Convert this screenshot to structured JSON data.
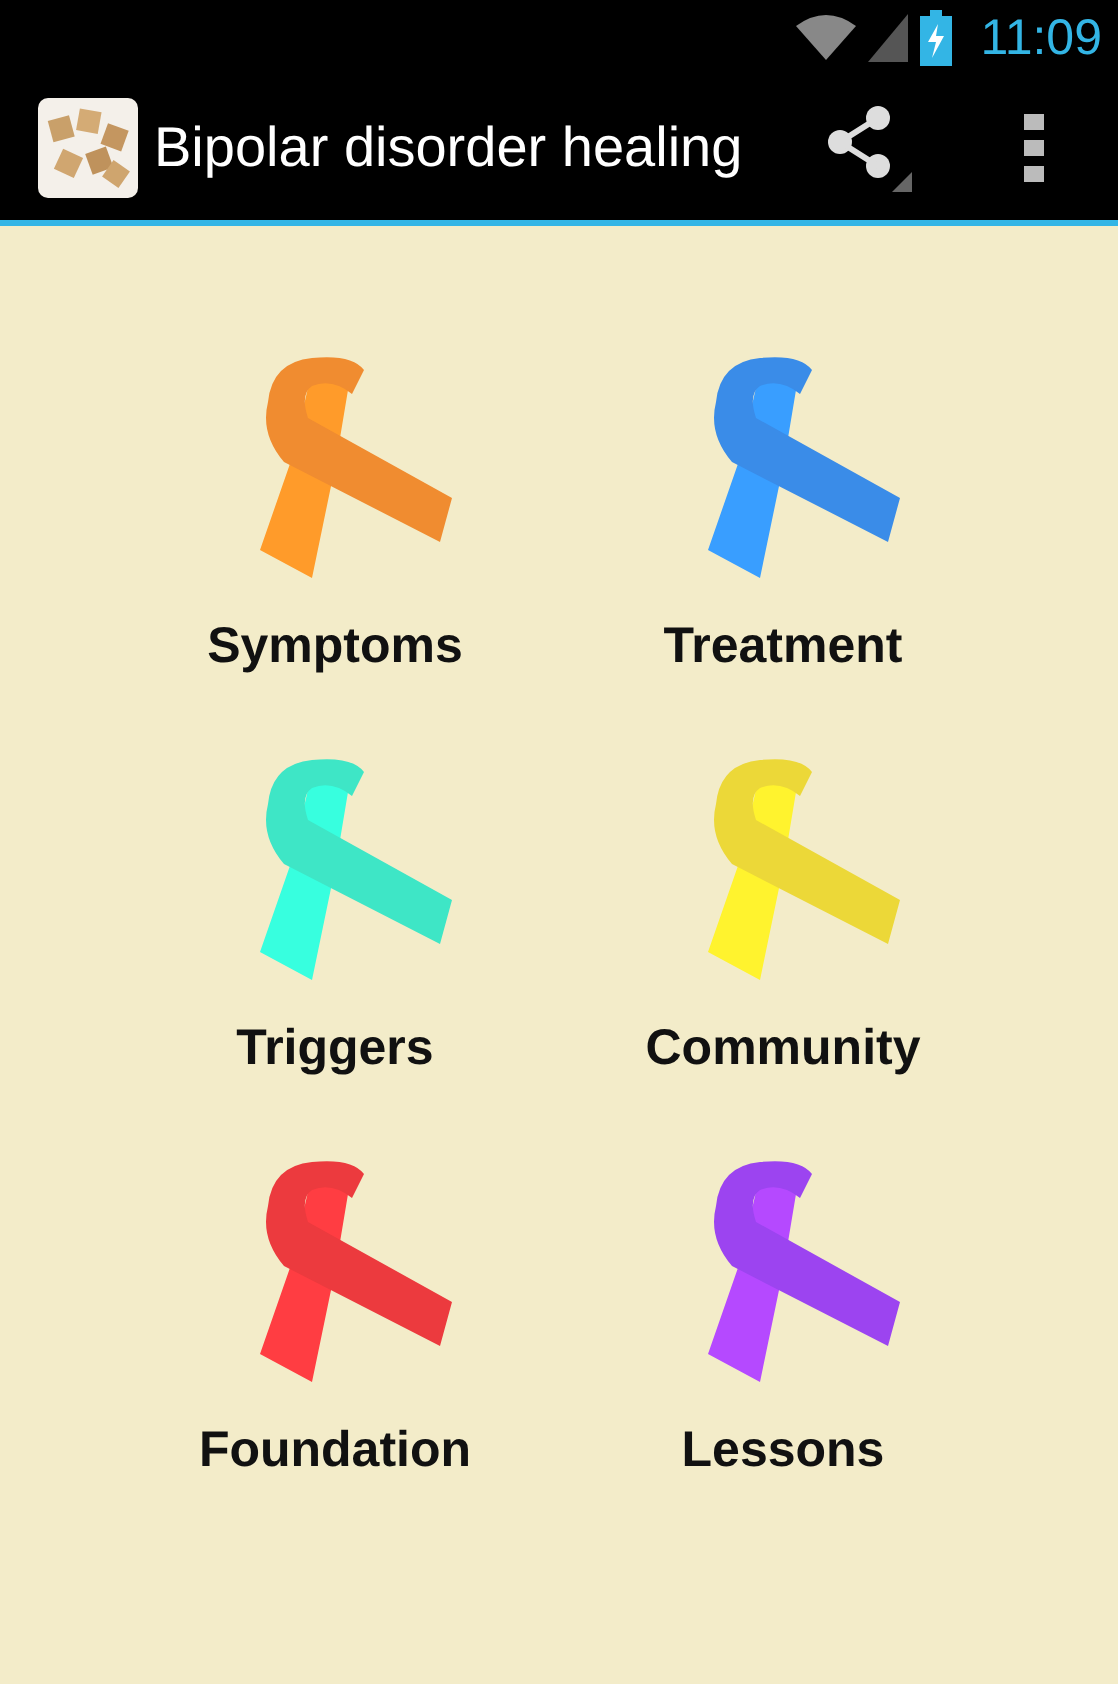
{
  "status_bar": {
    "time": "11:09"
  },
  "action_bar": {
    "title": "Bipolar disorder healing"
  },
  "tiles": [
    {
      "label": "Symptoms",
      "color": "#f08c30"
    },
    {
      "label": "Treatment",
      "color": "#3a8ce8"
    },
    {
      "label": "Triggers",
      "color": "#3ee6c6"
    },
    {
      "label": "Community",
      "color": "#ecd838"
    },
    {
      "label": "Foundation",
      "color": "#ec3a3e"
    },
    {
      "label": "Lessons",
      "color": "#9c44f0"
    }
  ]
}
